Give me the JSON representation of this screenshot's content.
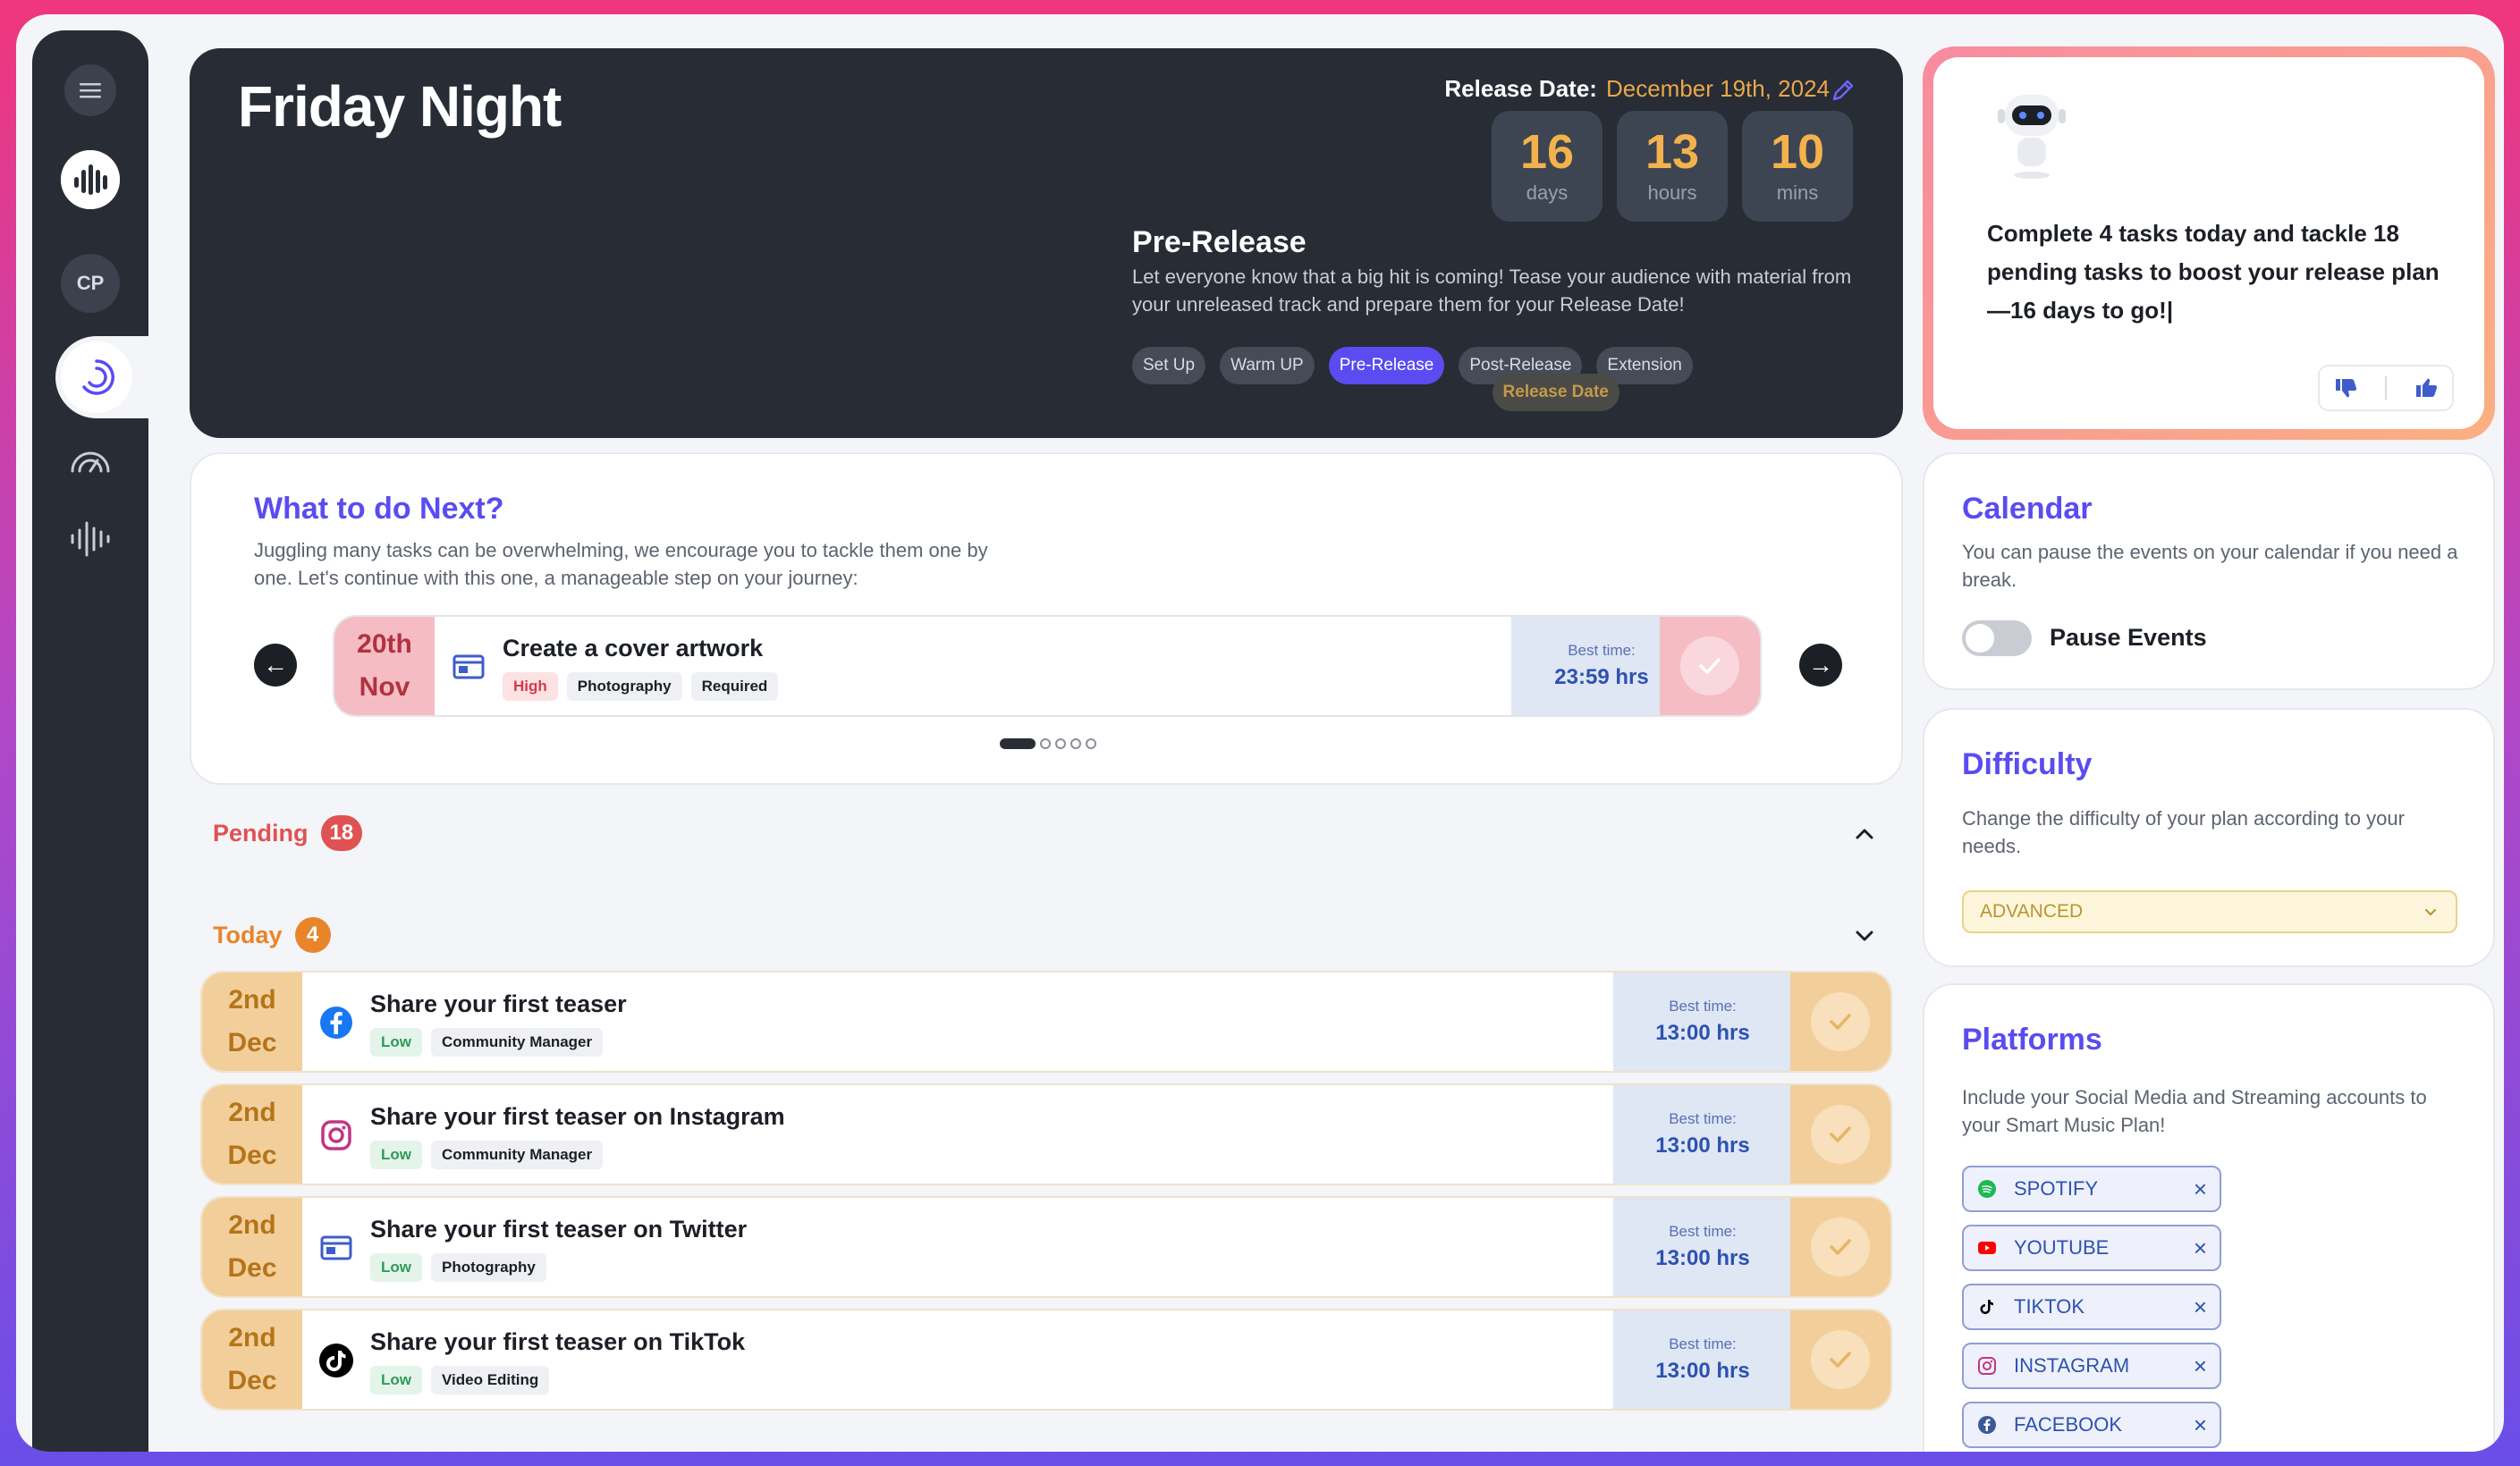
{
  "sidebar": {
    "cp_label": "CP"
  },
  "hero": {
    "title": "Friday Night",
    "release_label": "Release Date:",
    "release_date": "December 19th, 2024",
    "countdown": [
      {
        "value": "16",
        "unit": "days"
      },
      {
        "value": "13",
        "unit": "hours"
      },
      {
        "value": "10",
        "unit": "mins"
      }
    ],
    "phase_title": "Pre-Release",
    "phase_description": "Let everyone know that a big hit is coming! Tease your audience with material from your unreleased track and prepare them for your Release Date!",
    "phases": [
      {
        "label": "Set Up",
        "state": "default"
      },
      {
        "label": "Warm UP",
        "state": "default"
      },
      {
        "label": "Pre-Release",
        "state": "active"
      },
      {
        "label": "Release Date",
        "state": "release"
      },
      {
        "label": "Post-Release",
        "state": "default"
      },
      {
        "label": "Extension",
        "state": "default"
      }
    ]
  },
  "assistant": {
    "message": "Complete 4 tasks today and tackle 18 pending tasks to boost your release plan—16 days to go!|"
  },
  "next": {
    "title": "What to do Next?",
    "description": "Juggling many tasks can be overwhelming, we encourage you to tackle them one by one. Let's continue with this one, a manageable step on your journey:",
    "task": {
      "day": "20th",
      "month": "Nov",
      "title": "Create a cover artwork",
      "tags": [
        "High",
        "Photography",
        "Required"
      ],
      "best_label": "Best time:",
      "best_time": "23:59 hrs",
      "icon": "artwork-icon"
    },
    "carousel_pages": 5,
    "carousel_active": 1
  },
  "pending": {
    "label": "Pending",
    "count": "18"
  },
  "today": {
    "label": "Today",
    "count": "4",
    "tasks": [
      {
        "day": "2nd",
        "month": "Dec",
        "title": "Share your first teaser",
        "tags": [
          "Low",
          "Community Manager"
        ],
        "best_label": "Best time:",
        "best_time": "13:00 hrs",
        "icon": "facebook-icon"
      },
      {
        "day": "2nd",
        "month": "Dec",
        "title": "Share your first teaser on Instagram",
        "tags": [
          "Low",
          "Community Manager"
        ],
        "best_label": "Best time:",
        "best_time": "13:00 hrs",
        "icon": "instagram-icon"
      },
      {
        "day": "2nd",
        "month": "Dec",
        "title": "Share your first teaser on Twitter",
        "tags": [
          "Low",
          "Photography"
        ],
        "best_label": "Best time:",
        "best_time": "13:00 hrs",
        "icon": "artwork-icon"
      },
      {
        "day": "2nd",
        "month": "Dec",
        "title": "Share your first teaser on TikTok",
        "tags": [
          "Low",
          "Video Editing"
        ],
        "best_label": "Best time:",
        "best_time": "13:00 hrs",
        "icon": "tiktok-icon"
      }
    ]
  },
  "calendar": {
    "title": "Calendar",
    "description": "You can pause the events on your calendar if you need a break.",
    "toggle_label": "Pause Events",
    "paused": false
  },
  "difficulty": {
    "title": "Difficulty",
    "description": "Change the difficulty of your plan according to your needs.",
    "selected": "ADVANCED"
  },
  "platforms": {
    "title": "Platforms",
    "description": "Include your Social Media and Streaming accounts to your Smart Music Plan!",
    "items": [
      {
        "label": "SPOTIFY",
        "icon": "spotify-icon",
        "color": "#1DB954"
      },
      {
        "label": "YOUTUBE",
        "icon": "youtube-icon",
        "color": "#FF0000"
      },
      {
        "label": "TIKTOK",
        "icon": "tiktok-icon",
        "color": "#000000"
      },
      {
        "label": "INSTAGRAM",
        "icon": "instagram-icon",
        "color": "#C13584"
      },
      {
        "label": "FACEBOOK",
        "icon": "facebook-icon",
        "color": "#3b5998"
      }
    ]
  },
  "colors": {
    "accent": "#5a4cf0",
    "pending": "#e05252",
    "today": "#e8852a",
    "best_time": "#2c52b0"
  }
}
